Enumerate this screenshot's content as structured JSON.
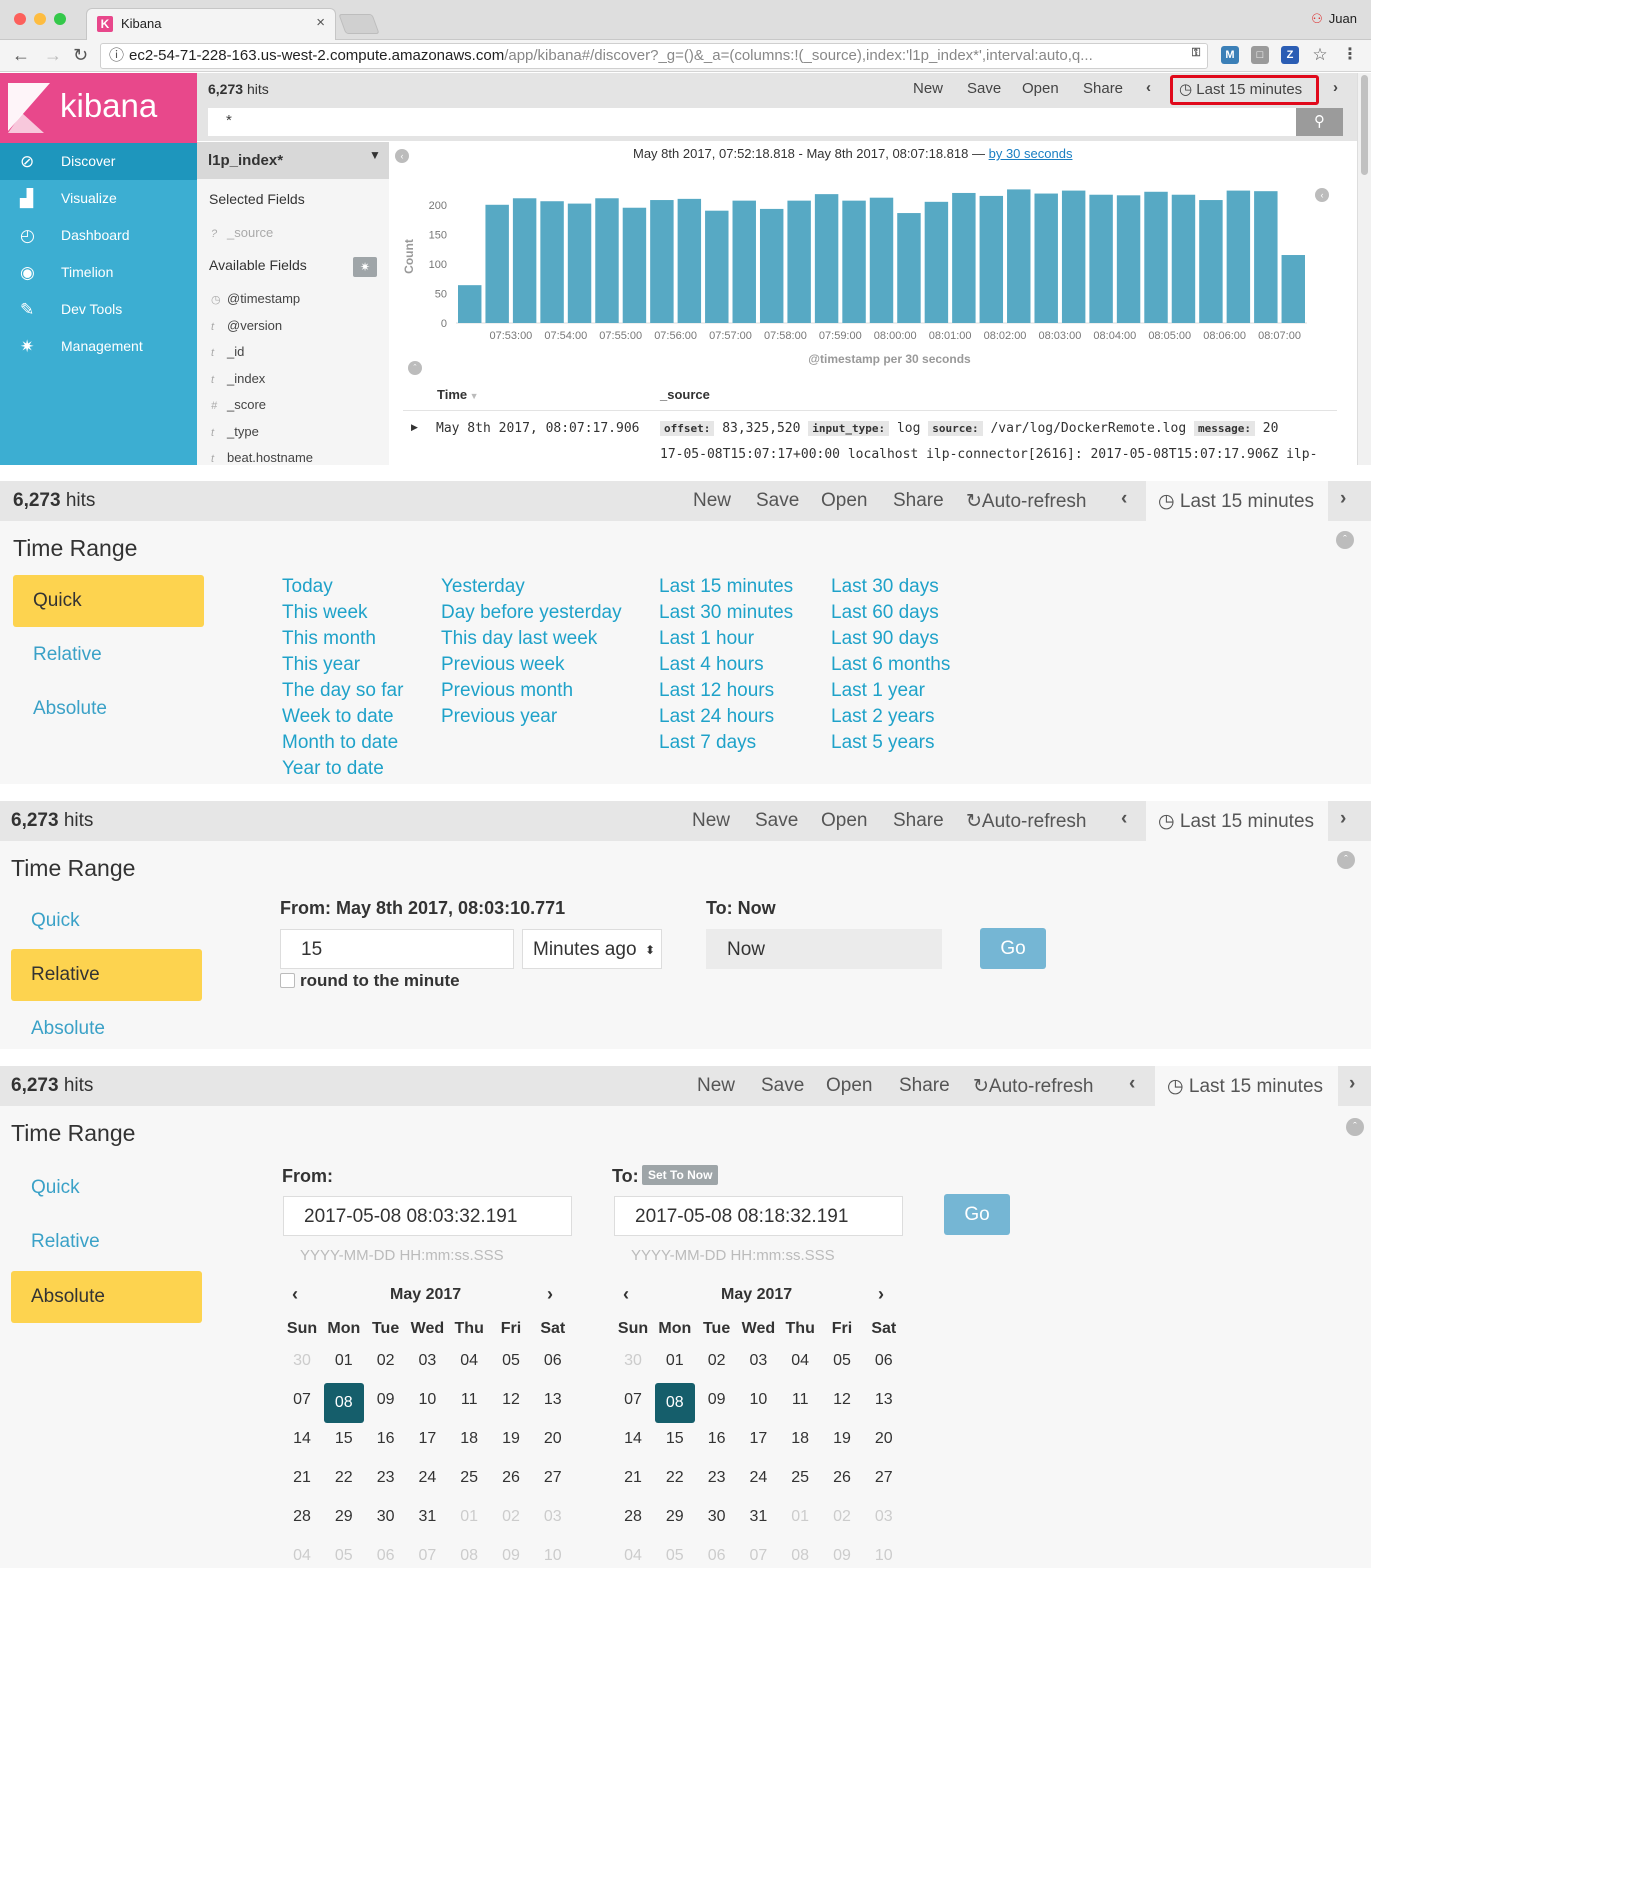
{
  "browser": {
    "tab_title": "Kibana",
    "user": "Juan",
    "url_host": "ec2-54-71-228-163.us-west-2.compute.amazonaws.com",
    "url_rest": "/app/kibana#/discover?_g=()&_a=(columns:!(_source),index:'l1p_index*',interval:auto,q..."
  },
  "sidebar": {
    "logo_text": "kibana",
    "items": [
      {
        "label": "Discover",
        "icon": "compass-icon"
      },
      {
        "label": "Visualize",
        "icon": "bar-chart-icon"
      },
      {
        "label": "Dashboard",
        "icon": "dashboard-icon"
      },
      {
        "label": "Timelion",
        "icon": "timelion-icon"
      },
      {
        "label": "Dev Tools",
        "icon": "wrench-icon"
      },
      {
        "label": "Management",
        "icon": "gear-icon"
      }
    ]
  },
  "topnav": {
    "hits_count": "6,273",
    "hits_label": "hits",
    "new": "New",
    "save": "Save",
    "open": "Open",
    "share": "Share",
    "auto_refresh": "Auto-refresh",
    "time_label": "Last 15 minutes"
  },
  "search": {
    "query": "*"
  },
  "fields": {
    "index_pattern": "l1p_index*",
    "selected_header": "Selected Fields",
    "selected": [
      {
        "type": "?",
        "name": "_source"
      }
    ],
    "available_header": "Available Fields",
    "available": [
      {
        "type": "◷",
        "name": "@timestamp"
      },
      {
        "type": "t",
        "name": "@version"
      },
      {
        "type": "t",
        "name": "_id"
      },
      {
        "type": "t",
        "name": "_index"
      },
      {
        "type": "#",
        "name": "_score"
      },
      {
        "type": "t",
        "name": "_type"
      },
      {
        "type": "t",
        "name": "beat.hostname"
      }
    ]
  },
  "histogram": {
    "range_text": "May 8th 2017, 07:52:18.818 - May 8th 2017, 08:07:18.818 —",
    "interval_link": "by 30 seconds",
    "xlabel": "@timestamp per 30 seconds",
    "ylabel": "Count"
  },
  "chart_data": {
    "type": "bar",
    "xlabel": "@timestamp per 30 seconds",
    "ylabel": "Count",
    "ylim": [
      0,
      225
    ],
    "yticks": [
      0,
      50,
      100,
      150,
      200
    ],
    "xticks": [
      "07:53:00",
      "07:54:00",
      "07:55:00",
      "07:56:00",
      "07:57:00",
      "07:58:00",
      "07:59:00",
      "08:00:00",
      "08:01:00",
      "08:02:00",
      "08:03:00",
      "08:04:00",
      "08:05:00",
      "08:06:00",
      "08:07:00"
    ],
    "values": [
      64,
      200,
      211,
      206,
      202,
      211,
      195,
      208,
      210,
      190,
      207,
      193,
      207,
      218,
      207,
      212,
      186,
      205,
      220,
      215,
      226,
      219,
      224,
      217,
      216,
      222,
      217,
      208,
      224,
      223,
      115
    ]
  },
  "doc_table": {
    "col_time": "Time",
    "col_source": "_source",
    "row_time": "May 8th 2017, 08:07:17.906",
    "row_source_line1": [
      {
        "k": "offset:",
        "v": "83,325,520"
      },
      {
        "k": "input_type:",
        "v": "log"
      },
      {
        "k": "source:",
        "v": "/var/log/DockerRemote.log"
      },
      {
        "k": "message:",
        "v": "20"
      }
    ],
    "row_source_line2": "17-05-08T15:07:17+00:00 localhost ilp-connector[2616]: 2017-05-08T15:07:17.906Z ilp-"
  },
  "timerange": {
    "title": "Time Range",
    "tabs": [
      "Quick",
      "Relative",
      "Absolute"
    ],
    "quick_cols": [
      [
        "Today",
        "This week",
        "This month",
        "This year",
        "The day so far",
        "Week to date",
        "Month to date",
        "Year to date"
      ],
      [
        "Yesterday",
        "Day before yesterday",
        "This day last week",
        "Previous week",
        "Previous month",
        "Previous year"
      ],
      [
        "Last 15 minutes",
        "Last 30 minutes",
        "Last 1 hour",
        "Last 4 hours",
        "Last 12 hours",
        "Last 24 hours",
        "Last 7 days"
      ],
      [
        "Last 30 days",
        "Last 60 days",
        "Last 90 days",
        "Last 6 months",
        "Last 1 year",
        "Last 2 years",
        "Last 5 years"
      ]
    ],
    "relative": {
      "from_label": "From: May 8th 2017, 08:03:10.771",
      "from_value": "15",
      "unit": "Minutes ago",
      "round_label": "round to the minute",
      "to_label": "To: Now",
      "to_value": "Now",
      "go": "Go"
    },
    "absolute": {
      "from_label": "From:",
      "to_label": "To:",
      "set_to_now": "Set To Now",
      "from_value": "2017-05-08 08:03:32.191",
      "to_value": "2017-05-08 08:18:32.191",
      "format_hint": "YYYY-MM-DD HH:mm:ss.SSS",
      "go": "Go",
      "month": "May 2017",
      "weekdays": [
        "Sun",
        "Mon",
        "Tue",
        "Wed",
        "Thu",
        "Fri",
        "Sat"
      ],
      "weeks": [
        [
          "30",
          "01",
          "02",
          "03",
          "04",
          "05",
          "06"
        ],
        [
          "07",
          "08",
          "09",
          "10",
          "11",
          "12",
          "13"
        ],
        [
          "14",
          "15",
          "16",
          "17",
          "18",
          "19",
          "20"
        ],
        [
          "21",
          "22",
          "23",
          "24",
          "25",
          "26",
          "27"
        ],
        [
          "28",
          "29",
          "30",
          "31",
          "01",
          "02",
          "03"
        ],
        [
          "04",
          "05",
          "06",
          "07",
          "08",
          "09",
          "10"
        ]
      ],
      "selected_day": "08"
    }
  }
}
